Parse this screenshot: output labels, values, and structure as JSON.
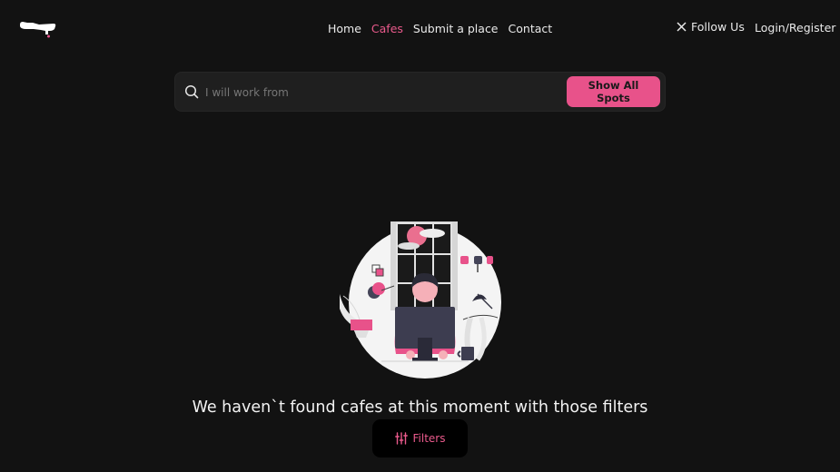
{
  "nav": {
    "items": [
      {
        "label": "Home",
        "active": false
      },
      {
        "label": "Cafes",
        "active": true
      },
      {
        "label": "Submit a place",
        "active": false
      },
      {
        "label": "Contact",
        "active": false
      }
    ],
    "follow_label": "Follow Us",
    "login_label": "Login/Register"
  },
  "search": {
    "placeholder": "I will work from",
    "value": "",
    "button_label": "Show All Spots"
  },
  "empty_state": {
    "message": "We haven`t found cafes at this moment with those filters"
  },
  "filters": {
    "label": "Filters"
  },
  "colors": {
    "background": "#121212",
    "accent": "#e8528a",
    "search_bg": "#1f1f1f"
  },
  "icons": {
    "logo": "coffee-logo-icon",
    "x": "x-icon",
    "search": "search-icon",
    "filters": "sliders-icon"
  }
}
